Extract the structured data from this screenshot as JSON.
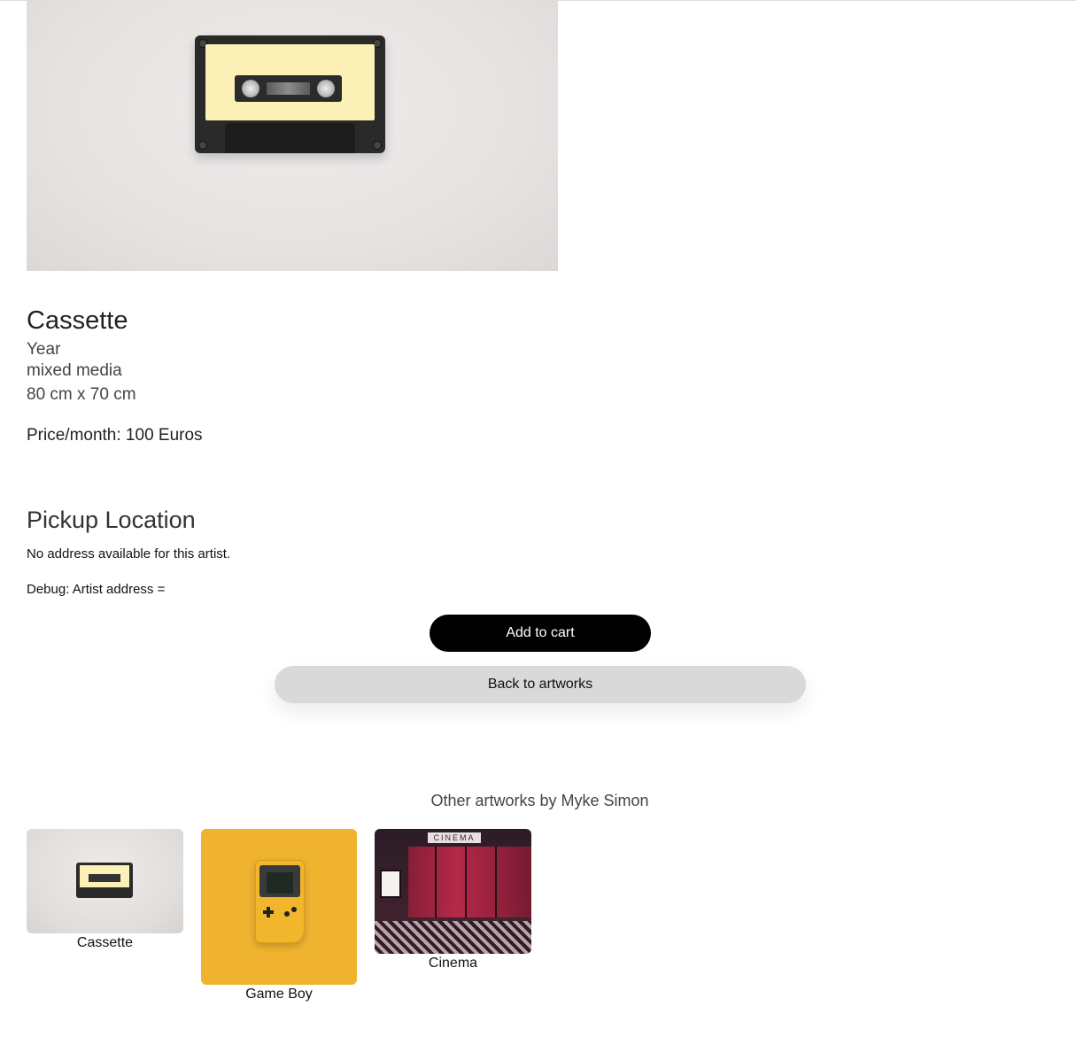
{
  "artwork": {
    "title": "Cassette",
    "year": "Year",
    "medium": "mixed media",
    "dimensions": "80 cm x 70 cm",
    "price": "Price/month: 100 Euros"
  },
  "pickup": {
    "heading": "Pickup Location",
    "message": "No address available for this artist.",
    "debug": "Debug: Artist address ="
  },
  "actions": {
    "add_to_cart": "Add to cart",
    "back": "Back to artworks"
  },
  "others": {
    "heading": "Other artworks by Myke Simon",
    "items": [
      {
        "title": "Cassette"
      },
      {
        "title": "Game Boy"
      },
      {
        "title": "Cinema"
      }
    ],
    "cinema_sign": "CINEMA"
  },
  "colors": {
    "button_primary": "#000000",
    "button_secondary": "#d9d9d9",
    "gameboy_bg": "#f0b330"
  }
}
